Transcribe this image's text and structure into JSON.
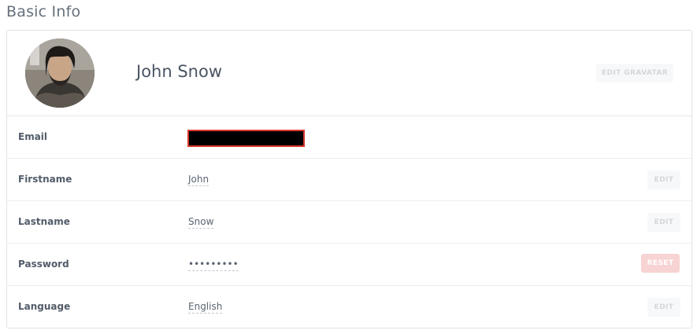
{
  "page": {
    "title": "Basic Info"
  },
  "profile": {
    "name": "John Snow",
    "edit_gravatar_label": "EDIT GRAVATAR"
  },
  "rows": [
    {
      "label": "Email",
      "value": ""
    },
    {
      "label": "Firstname",
      "value": "John",
      "button": "EDIT"
    },
    {
      "label": "Lastname",
      "value": "Snow",
      "button": "EDIT"
    },
    {
      "label": "Password",
      "value": "•••••••••",
      "button": "RESET"
    },
    {
      "label": "Language",
      "value": "English",
      "button": "EDIT"
    }
  ],
  "colors": {
    "reset_button": "#f8d3d3",
    "redaction_border": "#d9382c"
  }
}
